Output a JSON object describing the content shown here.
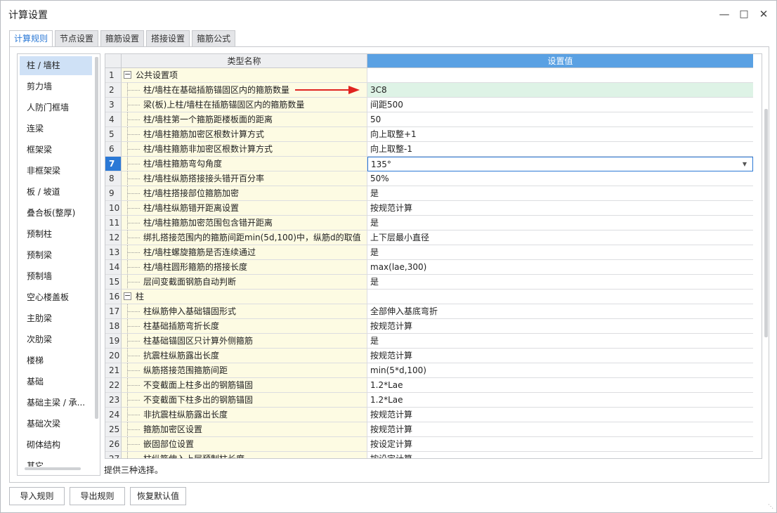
{
  "window": {
    "title": "计算设置"
  },
  "tabs": [
    "计算规则",
    "节点设置",
    "箍筋设置",
    "搭接设置",
    "箍筋公式"
  ],
  "sidebar": {
    "items": [
      "柱 / 墙柱",
      "剪力墙",
      "人防门框墙",
      "连梁",
      "框架梁",
      "非框架梁",
      "板 / 坡道",
      "叠合板(整厚)",
      "预制柱",
      "预制梁",
      "预制墙",
      "空心楼盖板",
      "主肋梁",
      "次肋梁",
      "楼梯",
      "基础",
      "基础主梁 / 承...",
      "基础次梁",
      "砌体结构",
      "其它"
    ]
  },
  "grid": {
    "headers": {
      "name": "类型名称",
      "value": "设置值"
    },
    "rows": [
      {
        "num": "1",
        "name": "公共设置项",
        "value": "",
        "group": true
      },
      {
        "num": "2",
        "name": "柱/墙柱在基础插筋锚固区内的箍筋数量",
        "value": "3C8"
      },
      {
        "num": "3",
        "name": "梁(板)上柱/墙柱在插筋锚固区内的箍筋数量",
        "value": "间距500"
      },
      {
        "num": "4",
        "name": "柱/墙柱第一个箍筋距楼板面的距离",
        "value": "50"
      },
      {
        "num": "5",
        "name": "柱/墙柱箍筋加密区根数计算方式",
        "value": "向上取整+1"
      },
      {
        "num": "6",
        "name": "柱/墙柱箍筋非加密区根数计算方式",
        "value": "向上取整-1"
      },
      {
        "num": "7",
        "name": "柱/墙柱箍筋弯勾角度",
        "value": "135°"
      },
      {
        "num": "8",
        "name": "柱/墙柱纵筋搭接接头错开百分率",
        "value": "50%"
      },
      {
        "num": "9",
        "name": "柱/墙柱搭接部位箍筋加密",
        "value": "是"
      },
      {
        "num": "10",
        "name": "柱/墙柱纵筋错开距离设置",
        "value": "按规范计算"
      },
      {
        "num": "11",
        "name": "柱/墙柱箍筋加密范围包含错开距离",
        "value": "是"
      },
      {
        "num": "12",
        "name": "绑扎搭接范围内的箍筋间距min(5d,100)中，纵筋d的取值",
        "value": "上下层最小直径"
      },
      {
        "num": "13",
        "name": "柱/墙柱螺旋箍筋是否连续通过",
        "value": "是"
      },
      {
        "num": "14",
        "name": "柱/墙柱圆形箍筋的搭接长度",
        "value": "max(lae,300)"
      },
      {
        "num": "15",
        "name": "层间变截面钢筋自动判断",
        "value": "是"
      },
      {
        "num": "16",
        "name": "柱",
        "value": "",
        "group": true
      },
      {
        "num": "17",
        "name": "柱纵筋伸入基础锚固形式",
        "value": "全部伸入基底弯折"
      },
      {
        "num": "18",
        "name": "柱基础插筋弯折长度",
        "value": "按规范计算"
      },
      {
        "num": "19",
        "name": "柱基础锚固区只计算外侧箍筋",
        "value": "是"
      },
      {
        "num": "20",
        "name": "抗震柱纵筋露出长度",
        "value": "按规范计算"
      },
      {
        "num": "21",
        "name": "纵筋搭接范围箍筋间距",
        "value": "min(5*d,100)"
      },
      {
        "num": "22",
        "name": "不变截面上柱多出的钢筋锚固",
        "value": "1.2*Lae"
      },
      {
        "num": "23",
        "name": "不变截面下柱多出的钢筋锚固",
        "value": "1.2*Lae"
      },
      {
        "num": "24",
        "name": "非抗震柱纵筋露出长度",
        "value": "按规范计算"
      },
      {
        "num": "25",
        "name": "箍筋加密区设置",
        "value": "按规范计算"
      },
      {
        "num": "26",
        "name": "嵌固部位设置",
        "value": "按设定计算"
      },
      {
        "num": "27",
        "name": "柱纵筋伸入上层预制柱长度",
        "value": "按设定计算"
      }
    ],
    "highlighted_row": "2",
    "selected_row": "7"
  },
  "description": "提供三种选择。",
  "buttons": {
    "import": "导入规则",
    "export": "导出规则",
    "restore": "恢复默认值"
  },
  "icons": {
    "minimize": "minimize-icon",
    "maximize": "maximize-icon",
    "close": "close-icon",
    "expand": "collapse-icon",
    "dropdown": "dropdown-arrow-icon",
    "arrow": "red-arrow-annotation"
  },
  "colors": {
    "accent": "#2b79d6",
    "header_value_bg": "#5aa1e3",
    "name_col_bg": "#fdfbe3",
    "highlight_row_bg": "#def3e6",
    "arrow": "#e0231f"
  }
}
